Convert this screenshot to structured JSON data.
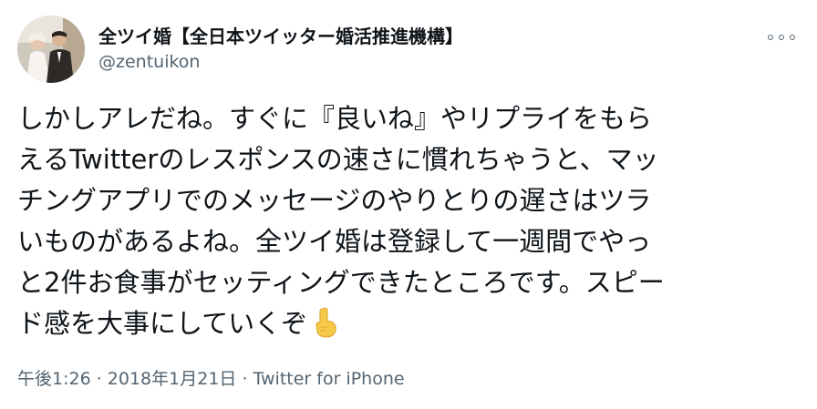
{
  "tweet": {
    "author": {
      "display_name": "全ツイ婚【全日本ツイッター婚活推進機構】",
      "handle": "@zentuikon"
    },
    "text_lines": [
      "しかしアレだね。すぐに『良いね』やリプライをもら",
      "えるTwitterのレスポンスの速さに慣れちゃうと、マッ",
      "チングアプリでのメッセージのやりとりの遅さはツラ",
      "いものがあるよね。全ツイ婚は登録して一週間でやっ",
      "と2件お食事がセッティングできたところです。スピー",
      "ド感を大事にしていくぞ"
    ],
    "emoji": "finger-pointing-up-emoji",
    "meta": {
      "time": "午後1:26",
      "separator": " · ",
      "date": "2018年1月21日",
      "source": "Twitter for iPhone"
    }
  },
  "colors": {
    "text": "#0f1419",
    "secondary": "#536471",
    "emoji": "#f7c94a"
  }
}
